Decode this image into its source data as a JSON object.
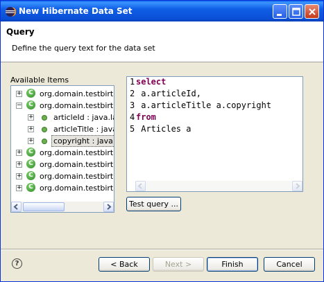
{
  "window": {
    "title": "New Hibernate Data Set"
  },
  "header": {
    "title": "Query",
    "description": "Define the query text for the data set"
  },
  "available": {
    "label": "Available Items",
    "tree": [
      {
        "label": "org.domain.testbirt.en",
        "type": "class",
        "expander": "+"
      },
      {
        "label": "org.domain.testbirt.en",
        "type": "class",
        "expander": "−"
      },
      {
        "label": "articleId : java.lan",
        "type": "field",
        "expander": "+"
      },
      {
        "label": "articleTitle : java.la",
        "type": "field",
        "expander": "+"
      },
      {
        "label": "copyright : java.ut",
        "type": "field",
        "expander": "+"
      },
      {
        "label": "org.domain.testbirt.en",
        "type": "class",
        "expander": "+"
      },
      {
        "label": "org.domain.testbirt.en",
        "type": "class",
        "expander": "+"
      },
      {
        "label": "org.domain.testbirt.en",
        "type": "class",
        "expander": "+"
      },
      {
        "label": "org.domain.testbirt.en",
        "type": "class",
        "expander": "+"
      }
    ]
  },
  "editor": {
    "lines": [
      {
        "num": "1",
        "keyword": "select",
        "text": ""
      },
      {
        "num": "2",
        "keyword": "",
        "text": " a.articleId,"
      },
      {
        "num": "3",
        "keyword": "",
        "text": " a.articleTitle a.copyright"
      },
      {
        "num": "4",
        "keyword": "from",
        "text": ""
      },
      {
        "num": "5",
        "keyword": "",
        "text": " Articles a"
      }
    ]
  },
  "buttons": {
    "test_query": "Test query ...",
    "back": "< Back",
    "next": "Next >",
    "finish": "Finish",
    "cancel": "Cancel"
  },
  "help": {
    "glyph": "?"
  },
  "colors": {
    "keyword": "#7f0055",
    "title_bar": "#0a4fd6",
    "class_icon": "#2f8a2a"
  }
}
